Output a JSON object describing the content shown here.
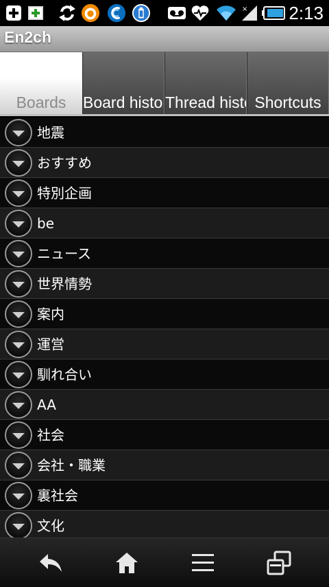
{
  "status_bar": {
    "time": "2:13",
    "icons": [
      "add-icon",
      "image-plus-icon",
      "sync-icon",
      "orange-circle-icon",
      "blue-circle-icon",
      "battery-widget-icon",
      "voicemail-icon",
      "heart-icon",
      "wifi-icon",
      "signal-icon",
      "battery-icon"
    ]
  },
  "app": {
    "title": "En2ch"
  },
  "tabs": [
    {
      "label": "Boards",
      "active": true
    },
    {
      "label": "Board history",
      "active": false
    },
    {
      "label": "Thread history",
      "active": false
    },
    {
      "label": "Shortcuts",
      "active": false
    }
  ],
  "boards": [
    {
      "label": "地震"
    },
    {
      "label": "おすすめ"
    },
    {
      "label": "特別企画"
    },
    {
      "label": "be"
    },
    {
      "label": "ニュース"
    },
    {
      "label": "世界情勢"
    },
    {
      "label": "案内"
    },
    {
      "label": "運営"
    },
    {
      "label": "馴れ合い"
    },
    {
      "label": "AA"
    },
    {
      "label": "社会"
    },
    {
      "label": "会社・職業"
    },
    {
      "label": "裏社会"
    },
    {
      "label": "文化"
    }
  ],
  "nav": [
    "back-icon",
    "home-icon",
    "menu-icon",
    "recent-apps-icon"
  ]
}
